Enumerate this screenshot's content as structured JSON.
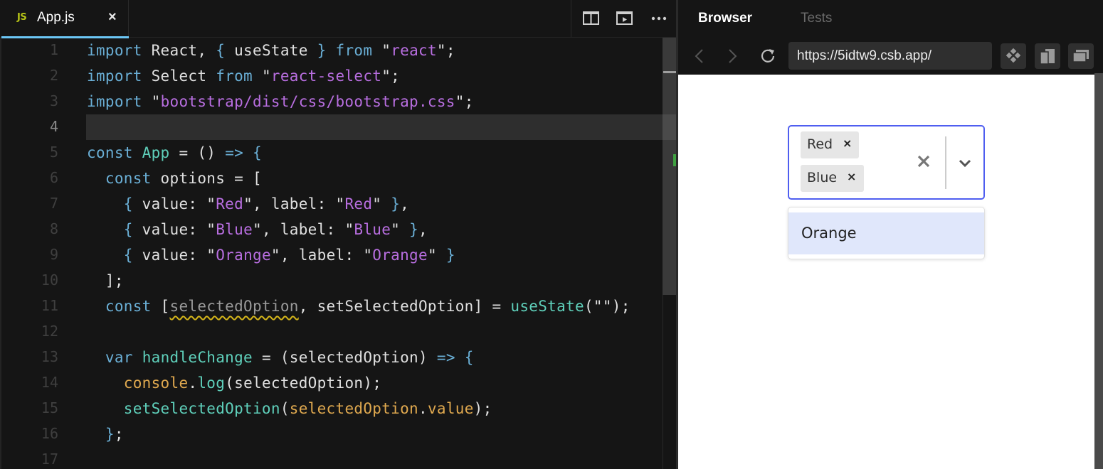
{
  "editor": {
    "tab": {
      "icon_text": "JS",
      "label": "App.js",
      "close": "×"
    },
    "actions": [
      "split-editor-icon",
      "open-preview-icon",
      "more-actions-icon"
    ],
    "active_line": 4,
    "line_numbers": [
      "1",
      "2",
      "3",
      "4",
      "5",
      "6",
      "7",
      "8",
      "9",
      "10",
      "11",
      "12",
      "13",
      "14",
      "15",
      "16",
      "17"
    ],
    "lines": [
      [
        [
          "kw",
          "import"
        ],
        [
          "plain",
          " React, "
        ],
        [
          "punc",
          "{"
        ],
        [
          "plain",
          " useState "
        ],
        [
          "punc",
          "}"
        ],
        [
          "kw",
          " from "
        ],
        [
          "plain",
          "\""
        ],
        [
          "str",
          "react"
        ],
        [
          "plain",
          "\";"
        ]
      ],
      [
        [
          "kw",
          "import"
        ],
        [
          "plain",
          " Select "
        ],
        [
          "kw",
          "from"
        ],
        [
          "plain",
          " \""
        ],
        [
          "str",
          "react-select"
        ],
        [
          "plain",
          "\";"
        ]
      ],
      [
        [
          "kw",
          "import"
        ],
        [
          "plain",
          " \""
        ],
        [
          "str",
          "bootstrap/dist/css/bootstrap.css"
        ],
        [
          "plain",
          "\";"
        ]
      ],
      [],
      [
        [
          "kw",
          "const"
        ],
        [
          "plain",
          " "
        ],
        [
          "fn",
          "App"
        ],
        [
          "plain",
          " = () "
        ],
        [
          "punc",
          "=>"
        ],
        [
          "plain",
          " "
        ],
        [
          "punc",
          "{"
        ]
      ],
      [
        [
          "plain",
          "  "
        ],
        [
          "kw",
          "const"
        ],
        [
          "plain",
          " options = ["
        ]
      ],
      [
        [
          "plain",
          "    "
        ],
        [
          "punc",
          "{"
        ],
        [
          "plain",
          " value: \""
        ],
        [
          "str",
          "Red"
        ],
        [
          "plain",
          "\", label: \""
        ],
        [
          "str",
          "Red"
        ],
        [
          "plain",
          "\" "
        ],
        [
          "punc",
          "}"
        ],
        [
          "plain",
          ","
        ]
      ],
      [
        [
          "plain",
          "    "
        ],
        [
          "punc",
          "{"
        ],
        [
          "plain",
          " value: \""
        ],
        [
          "str",
          "Blue"
        ],
        [
          "plain",
          "\", label: \""
        ],
        [
          "str",
          "Blue"
        ],
        [
          "plain",
          "\" "
        ],
        [
          "punc",
          "}"
        ],
        [
          "plain",
          ","
        ]
      ],
      [
        [
          "plain",
          "    "
        ],
        [
          "punc",
          "{"
        ],
        [
          "plain",
          " value: \""
        ],
        [
          "str",
          "Orange"
        ],
        [
          "plain",
          "\", label: \""
        ],
        [
          "str",
          "Orange"
        ],
        [
          "plain",
          "\" "
        ],
        [
          "punc",
          "}"
        ]
      ],
      [
        [
          "plain",
          "  ];"
        ]
      ],
      [
        [
          "plain",
          "  "
        ],
        [
          "kw",
          "const"
        ],
        [
          "plain",
          " ["
        ],
        [
          "dim squiggle",
          "selectedOption"
        ],
        [
          "plain",
          ", setSelectedOption] = "
        ],
        [
          "fn",
          "useState"
        ],
        [
          "plain",
          "(\"\");"
        ]
      ],
      [],
      [
        [
          "plain",
          "  "
        ],
        [
          "kw",
          "var"
        ],
        [
          "plain",
          " "
        ],
        [
          "fn",
          "handleChange"
        ],
        [
          "plain",
          " = (selectedOption) "
        ],
        [
          "punc",
          "=>"
        ],
        [
          "plain",
          " "
        ],
        [
          "punc",
          "{"
        ]
      ],
      [
        [
          "plain",
          "    "
        ],
        [
          "obj",
          "console"
        ],
        [
          "plain",
          "."
        ],
        [
          "fn",
          "log"
        ],
        [
          "plain",
          "(selectedOption);"
        ]
      ],
      [
        [
          "plain",
          "    "
        ],
        [
          "fn",
          "setSelectedOption"
        ],
        [
          "plain",
          "("
        ],
        [
          "obj",
          "selectedOption"
        ],
        [
          "plain",
          "."
        ],
        [
          "obj",
          "value"
        ],
        [
          "plain",
          ");"
        ]
      ],
      [
        [
          "plain",
          "  "
        ],
        [
          "punc",
          "}"
        ],
        [
          "plain",
          ";"
        ]
      ],
      []
    ]
  },
  "preview": {
    "tabs": [
      {
        "label": "Browser",
        "active": true
      },
      {
        "label": "Tests",
        "active": false
      }
    ],
    "url": "https://5idtw9.csb.app/",
    "nav": [
      "back-icon",
      "forward-icon",
      "refresh-icon"
    ],
    "tools": [
      "devtools-icon",
      "open-new-window-icon",
      "preview-window-icon"
    ],
    "select": {
      "selected": [
        {
          "label": "Red",
          "remove": "×"
        },
        {
          "label": "Blue",
          "remove": "×"
        }
      ],
      "menu_options": [
        "Orange"
      ],
      "focus_color": "#4f5ef0"
    }
  },
  "colors": {
    "editor_bg": "#151515",
    "keyword": "#6aafd6",
    "string": "#b86ee0",
    "function": "#5fd0bb",
    "object": "#e0a94f",
    "tab_accent": "#6cc7f6",
    "js_badge": "#b7c417"
  }
}
